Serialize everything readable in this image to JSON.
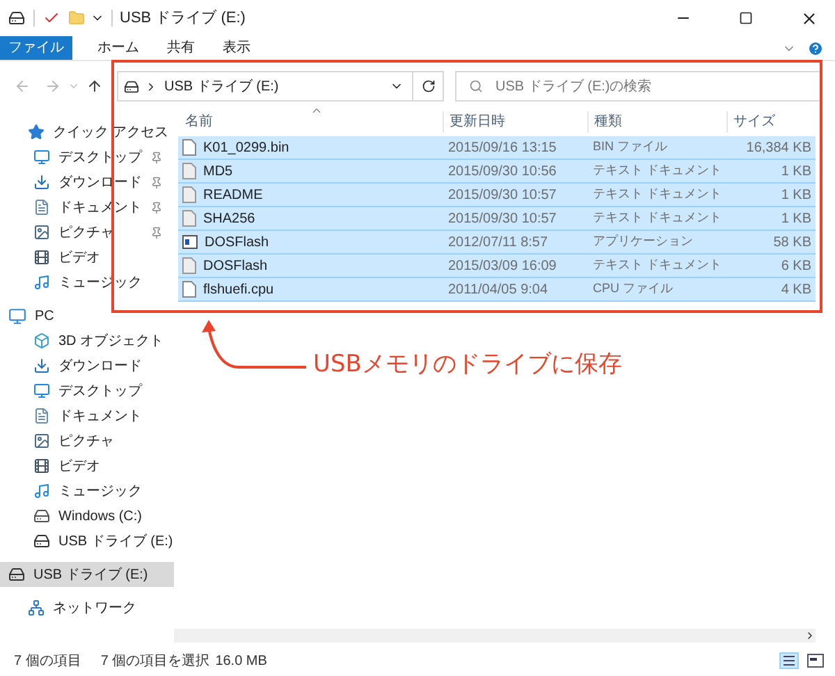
{
  "window": {
    "title": "USB ドライブ (E:)"
  },
  "ribbon": {
    "tabs": [
      {
        "label": "ファイル",
        "selected": true
      },
      {
        "label": "ホーム",
        "selected": false
      },
      {
        "label": "共有",
        "selected": false
      },
      {
        "label": "表示",
        "selected": false
      }
    ]
  },
  "address": {
    "path": "USB ドライブ (E:)"
  },
  "search": {
    "placeholder": "USB ドライブ (E:)の検索"
  },
  "sidebar": {
    "items": [
      {
        "label": "クイック アクセス",
        "kind": "quick",
        "selected": false,
        "children": [
          {
            "label": "デスクトップ",
            "kind": "desktop",
            "pinned": true,
            "selected": false
          },
          {
            "label": "ダウンロード",
            "kind": "download",
            "pinned": true,
            "selected": false
          },
          {
            "label": "ドキュメント",
            "kind": "document",
            "pinned": true,
            "selected": false
          },
          {
            "label": "ピクチャ",
            "kind": "picture",
            "pinned": true,
            "selected": false
          },
          {
            "label": "ビデオ",
            "kind": "video",
            "pinned": false,
            "selected": false
          },
          {
            "label": "ミュージック",
            "kind": "music",
            "pinned": false,
            "selected": false
          }
        ]
      },
      {
        "label": "PC",
        "kind": "pc",
        "selected": false,
        "children": [
          {
            "label": "3D オブジェクト",
            "kind": "objects3d",
            "selected": false
          },
          {
            "label": "ダウンロード",
            "kind": "download",
            "selected": false
          },
          {
            "label": "デスクトップ",
            "kind": "desktop",
            "selected": false
          },
          {
            "label": "ドキュメント",
            "kind": "document",
            "selected": false
          },
          {
            "label": "ピクチャ",
            "kind": "picture",
            "selected": false
          },
          {
            "label": "ビデオ",
            "kind": "video",
            "selected": false
          },
          {
            "label": "ミュージック",
            "kind": "music",
            "selected": false
          },
          {
            "label": "Windows (C:)",
            "kind": "drive",
            "selected": false
          },
          {
            "label": "USB ドライブ (E:)",
            "kind": "usb",
            "selected": false
          }
        ]
      },
      {
        "label": "USB ドライブ (E:)",
        "kind": "usb",
        "selected": true
      },
      {
        "label": "ネットワーク",
        "kind": "network",
        "selected": false
      }
    ]
  },
  "table": {
    "columns": [
      "名前",
      "更新日時",
      "種類",
      "サイズ"
    ],
    "rows": [
      {
        "name": "K01_0299.bin",
        "kind": "blank",
        "modified": "2015/09/16 13:15",
        "type": "BIN ファイル",
        "size": "16,384 KB",
        "selected": true
      },
      {
        "name": "MD5",
        "kind": "text",
        "modified": "2015/09/30 10:56",
        "type": "テキスト ドキュメント",
        "size": "1 KB",
        "selected": true
      },
      {
        "name": "README",
        "kind": "text",
        "modified": "2015/09/30 10:57",
        "type": "テキスト ドキュメント",
        "size": "1 KB",
        "selected": true
      },
      {
        "name": "SHA256",
        "kind": "text",
        "modified": "2015/09/30 10:57",
        "type": "テキスト ドキュメント",
        "size": "1 KB",
        "selected": true
      },
      {
        "name": "DOSFlash",
        "kind": "app",
        "modified": "2012/07/11 8:57",
        "type": "アプリケーション",
        "size": "58 KB",
        "selected": true
      },
      {
        "name": "DOSFlash",
        "kind": "text",
        "modified": "2015/03/09 16:09",
        "type": "テキスト ドキュメント",
        "size": "6 KB",
        "selected": true
      },
      {
        "name": "flshuefi.cpu",
        "kind": "blank",
        "modified": "2011/04/05 9:04",
        "type": "CPU ファイル",
        "size": "4 KB",
        "selected": true
      }
    ]
  },
  "annotation": {
    "text": "USBメモリのドライブに保存"
  },
  "status_bar": {
    "count": "7 個の項目",
    "selection": "7 個の項目を選択",
    "size": "16.0 MB"
  }
}
